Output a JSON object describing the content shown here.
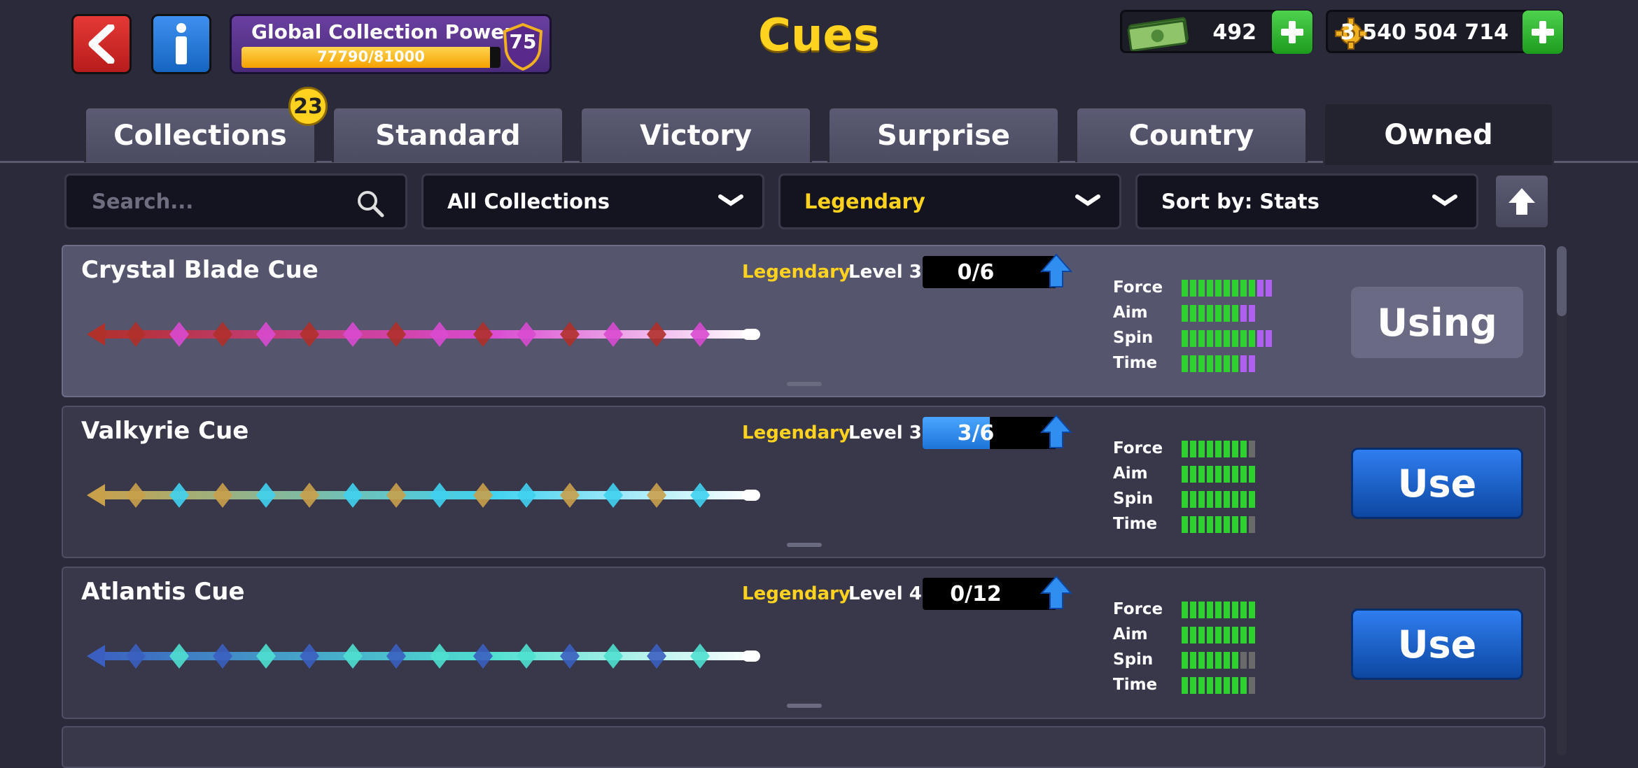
{
  "header": {
    "title": "Cues",
    "back_icon": "back-arrow-icon",
    "info_icon": "info-icon"
  },
  "collection_power": {
    "label": "Global Collection Power",
    "progress_text": "77790/81000",
    "progress_fraction": 0.96,
    "level": "75"
  },
  "currency": {
    "cash": "492",
    "coins": "3 540 504 714"
  },
  "tabs": [
    {
      "label": "Collections",
      "badge": "23"
    },
    {
      "label": "Standard"
    },
    {
      "label": "Victory"
    },
    {
      "label": "Surprise"
    },
    {
      "label": "Country"
    },
    {
      "label": "Owned",
      "active": true
    }
  ],
  "filters": {
    "search_placeholder": "Search...",
    "collection": "All Collections",
    "rarity": "Legendary",
    "sort": "Sort by: Stats"
  },
  "stat_labels": [
    "Force",
    "Aim",
    "Spin",
    "Time"
  ],
  "cues": [
    {
      "name": "Crystal Blade Cue",
      "rarity": "Legendary",
      "level": "Level 3",
      "pieces": "0/6",
      "pieces_fraction": 0,
      "action": "Using",
      "selected": true,
      "stats": [
        {
          "green": 9,
          "purple": 2,
          "grey": 0
        },
        {
          "green": 7,
          "purple": 2,
          "grey": 0
        },
        {
          "green": 9,
          "purple": 2,
          "grey": 0
        },
        {
          "green": 7,
          "purple": 2,
          "grey": 0
        }
      ],
      "colors": {
        "primary": "#d94ad0",
        "secondary": "#b0302a"
      }
    },
    {
      "name": "Valkyrie Cue",
      "rarity": "Legendary",
      "level": "Level 3",
      "pieces": "3/6",
      "pieces_fraction": 0.5,
      "action": "Use",
      "selected": false,
      "stats": [
        {
          "green": 8,
          "purple": 0,
          "grey": 1
        },
        {
          "green": 9,
          "purple": 0,
          "grey": 0
        },
        {
          "green": 9,
          "purple": 0,
          "grey": 0
        },
        {
          "green": 8,
          "purple": 0,
          "grey": 1
        }
      ],
      "colors": {
        "primary": "#3fd2f0",
        "secondary": "#c9a04a"
      }
    },
    {
      "name": "Atlantis Cue",
      "rarity": "Legendary",
      "level": "Level 4",
      "pieces": "0/12",
      "pieces_fraction": 0,
      "action": "Use",
      "selected": false,
      "stats": [
        {
          "green": 9,
          "purple": 0,
          "grey": 0
        },
        {
          "green": 9,
          "purple": 0,
          "grey": 0
        },
        {
          "green": 7,
          "purple": 0,
          "grey": 2
        },
        {
          "green": 8,
          "purple": 0,
          "grey": 1
        }
      ],
      "colors": {
        "primary": "#4fe0d0",
        "secondary": "#3b5fc0"
      }
    }
  ]
}
